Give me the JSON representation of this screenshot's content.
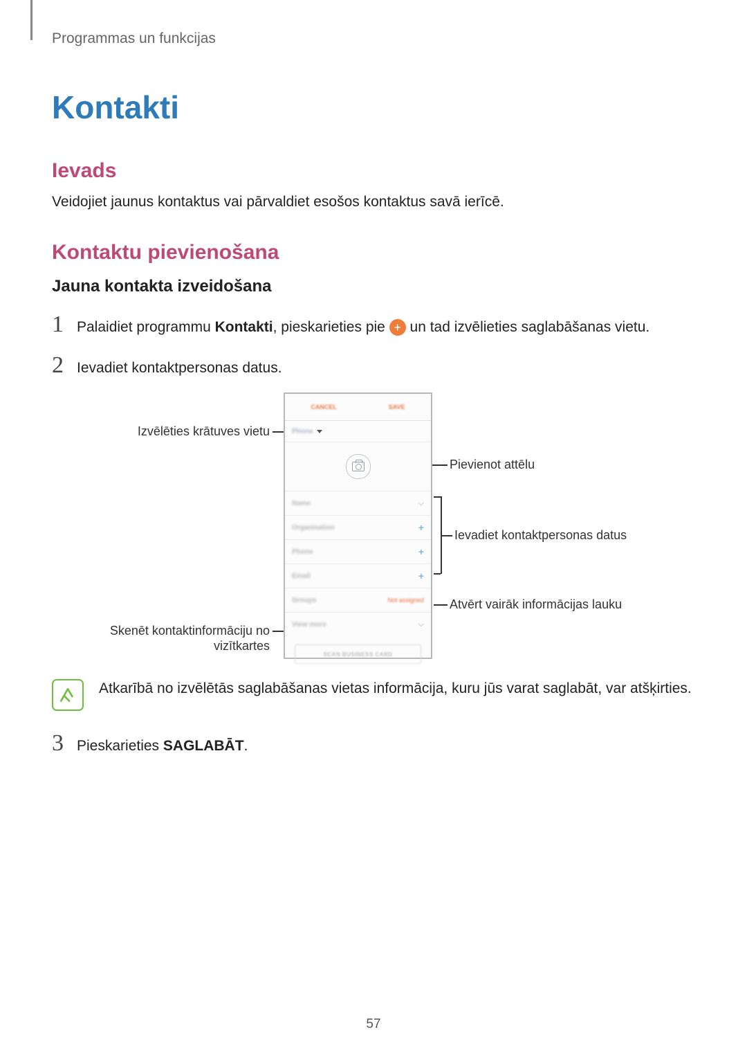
{
  "breadcrumb": "Programmas un funkcijas",
  "title": "Kontakti",
  "section_intro": {
    "heading": "Ievads",
    "body": "Veidojiet jaunus kontaktus vai pārvaldiet esošos kontaktus savā ierīcē."
  },
  "section_add": {
    "heading": "Kontaktu pievienošana",
    "subheading": "Jauna kontakta izveidošana"
  },
  "steps": {
    "s1_pre": "Palaidiet programmu ",
    "s1_bold": "Kontakti",
    "s1_mid": ", pieskarieties pie ",
    "s1_post": " un tad izvēlieties saglabāšanas vietu.",
    "s2": "Ievadiet kontaktpersonas datus.",
    "s3_pre": "Pieskarieties ",
    "s3_bold": "SAGLABĀT",
    "s3_post": "."
  },
  "callouts": {
    "storage": "Izvēlēties krātuves vietu",
    "photo": "Pievienot attēlu",
    "details": "Ievadiet kontaktpersonas datus",
    "more": "Atvērt vairāk informācijas lauku",
    "scan_line1": "Skenēt kontaktinformāciju no",
    "scan_line2": "vizītkartes"
  },
  "phone_ui": {
    "cancel": "CANCEL",
    "save": "SAVE",
    "storage_label": "Phone",
    "fields": {
      "name": "Name",
      "organisation": "Organisation",
      "phone": "Phone",
      "email": "Email",
      "groups": "Groups",
      "groups_value": "Not assigned",
      "view_more": "View more"
    },
    "scan_button": "SCAN BUSINESS CARD"
  },
  "note": "Atkarībā no izvēlētās saglabāšanas vietas informācija, kuru jūs varat saglabāt, var atšķirties.",
  "page_number": "57"
}
